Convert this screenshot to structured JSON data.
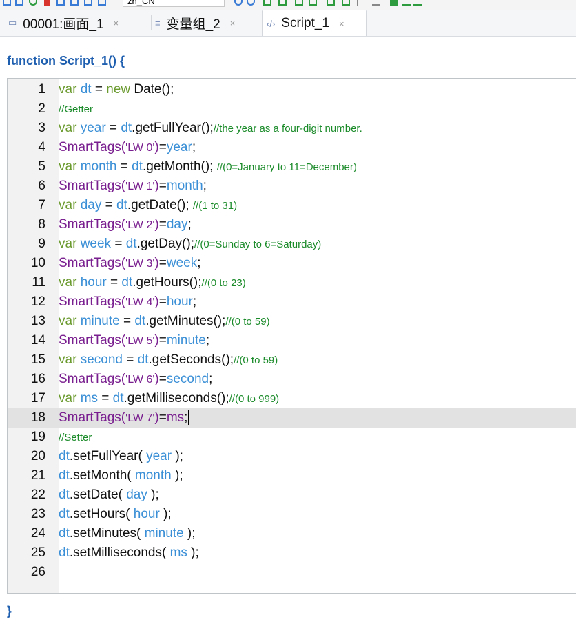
{
  "toolbar": {
    "language_value": "zh_CN"
  },
  "tabs": [
    {
      "label": "00001:画面_1",
      "icon": "screen-icon",
      "close": "×"
    },
    {
      "label": "变量组_2",
      "icon": "tag-table-icon",
      "close": "×"
    },
    {
      "label": "Script_1",
      "icon": "script-icon",
      "close": "×"
    }
  ],
  "editor": {
    "header": "function Script_1() {",
    "footer": "}",
    "current_line": 18,
    "line_numbers": [
      "1",
      "2",
      "3",
      "4",
      "5",
      "6",
      "7",
      "8",
      "9",
      "10",
      "11",
      "12",
      "13",
      "14",
      "15",
      "16",
      "17",
      "18",
      "19",
      "20",
      "21",
      "22",
      "23",
      "24",
      "25",
      "26"
    ],
    "comments": {
      "l2": "//Getter",
      "l3": "//the year as a four-digit number.",
      "l5": "//(0=January to 11=December)",
      "l7": "//(1 to 31)",
      "l9": "//(0=Sunday to 6=Saturday)",
      "l11": "//(0 to 23)",
      "l13": "//(0 to 59)",
      "l15": "//(0 to 59)",
      "l17": "//(0 to 999)",
      "l19": "//Setter"
    },
    "strings": {
      "lw0": "'LW 0'",
      "lw1": "'LW 1'",
      "lw2": "'LW 2'",
      "lw3": "'LW 3'",
      "lw4": "'LW 4'",
      "lw5": "'LW 5'",
      "lw6": "'LW 6'",
      "lw7": "'LW 7'"
    }
  }
}
